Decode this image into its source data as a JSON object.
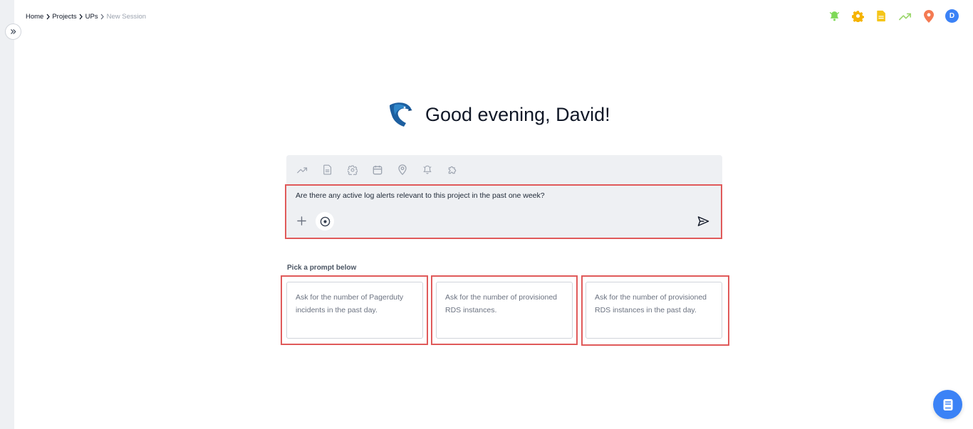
{
  "breadcrumb": {
    "items": [
      {
        "label": "Home"
      },
      {
        "label": "Projects"
      },
      {
        "label": "UPs"
      },
      {
        "label": "New Session"
      }
    ]
  },
  "header": {
    "icons": [
      "bell-icon",
      "gear-icon",
      "document-icon",
      "trending-up-icon",
      "location-pin-icon"
    ],
    "avatar_initial": "D",
    "colors": {
      "bell": "#7ed957",
      "gear": "#f5b301",
      "document": "#f5c518",
      "trend": "#9ad66a",
      "pin": "#f47a52",
      "avatar": "#3b82f6"
    }
  },
  "greeting": {
    "text": "Good evening, David!"
  },
  "composer": {
    "tools": [
      "trending-up-icon",
      "document-icon",
      "gear-icon",
      "calendar-icon",
      "location-pin-icon",
      "bell-icon",
      "puzzle-icon"
    ],
    "input_value": "Are there any active log alerts relevant to this project in the past one week?"
  },
  "prompts": {
    "heading": "Pick a prompt below",
    "cards": [
      {
        "text": "Ask for the number of Pagerduty incidents in the past day."
      },
      {
        "text": "Ask for the number of provisioned RDS instances."
      },
      {
        "text": "Ask for the number of provisioned RDS instances in the past day."
      }
    ]
  },
  "colors": {
    "accent": "#3b82f6",
    "highlight": "#e05a5a",
    "composer_bg": "#eef0f3"
  }
}
